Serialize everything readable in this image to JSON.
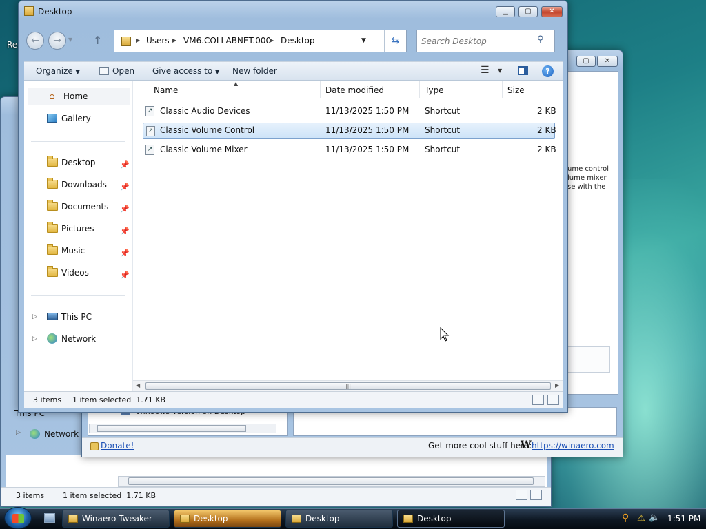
{
  "desktop": {
    "recycle_label": "Rec"
  },
  "bg_window": {
    "text_lines": [
      "ume control",
      "lume mixer",
      "se with the"
    ],
    "tree_item": "Windows Version on Desktop",
    "donate": "Donate!",
    "more_label": "Get more cool stuff here:",
    "winaero_mark": "W",
    "winaero_link": "https://winaero.com",
    "tree_this_pc": "This PC",
    "tree_network": "Network"
  },
  "back_explorer": {
    "items_count": "3 items",
    "selection": "1 item selected  1.71 KB"
  },
  "explorer": {
    "title": "Desktop",
    "address": [
      "Users",
      "VM6.COLLABNET.000",
      "Desktop"
    ],
    "search_placeholder": "Search Desktop",
    "toolbar": {
      "organize": "Organize",
      "open": "Open",
      "give_access": "Give access to",
      "new_folder": "New folder"
    },
    "nav": {
      "home": "Home",
      "gallery": "Gallery",
      "desktop": "Desktop",
      "downloads": "Downloads",
      "documents": "Documents",
      "pictures": "Pictures",
      "music": "Music",
      "videos": "Videos",
      "this_pc": "This PC",
      "network": "Network"
    },
    "columns": {
      "name": "Name",
      "date": "Date modified",
      "type": "Type",
      "size": "Size"
    },
    "files": [
      {
        "name": "Classic Audio Devices",
        "date": "11/13/2025 1:50 PM",
        "type": "Shortcut",
        "size": "2 KB"
      },
      {
        "name": "Classic Volume Control",
        "date": "11/13/2025 1:50 PM",
        "type": "Shortcut",
        "size": "2 KB"
      },
      {
        "name": "Classic Volume Mixer",
        "date": "11/13/2025 1:50 PM",
        "type": "Shortcut",
        "size": "2 KB"
      }
    ],
    "status": {
      "items": "3 items",
      "selection": "1 item selected  1.71 KB"
    }
  },
  "taskbar": {
    "tasks": [
      "Winaero Tweaker",
      "Desktop",
      "Desktop",
      "Desktop"
    ],
    "clock": "1:51 PM"
  },
  "colors": {
    "accent": "#2a6cc4",
    "selection": "#cde3f8",
    "link": "#1a4fb5"
  }
}
